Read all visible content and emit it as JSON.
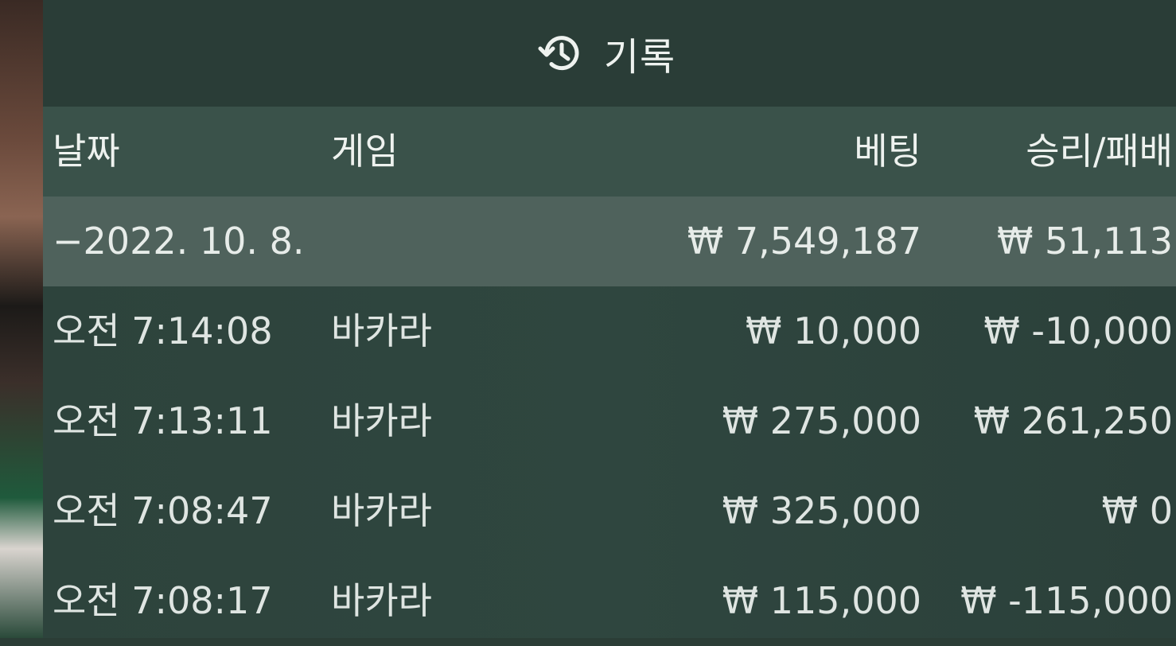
{
  "header": {
    "title": "기록",
    "icon": "history-icon"
  },
  "table": {
    "columns": {
      "date": "날짜",
      "game": "게임",
      "bet": "베팅",
      "result": "승리/패배"
    },
    "summary": {
      "date": "−2022. 10. 8.",
      "bet": "₩ 7,549,187",
      "result": "₩ 51,113"
    },
    "rows": [
      {
        "time": "오전 7:14:08",
        "game": "바카라",
        "bet": "₩ 10,000",
        "result": "₩ -10,000"
      },
      {
        "time": "오전 7:13:11",
        "game": "바카라",
        "bet": "₩ 275,000",
        "result": "₩ 261,250"
      },
      {
        "time": "오전 7:08:47",
        "game": "바카라",
        "bet": "₩ 325,000",
        "result": "₩ 0"
      },
      {
        "time": "오전 7:08:17",
        "game": "바카라",
        "bet": "₩ 115,000",
        "result": "₩ -115,000"
      }
    ]
  },
  "colors": {
    "panel": "#2d433c",
    "header_row": "#3a524a",
    "summary_row": "#4f625c"
  }
}
